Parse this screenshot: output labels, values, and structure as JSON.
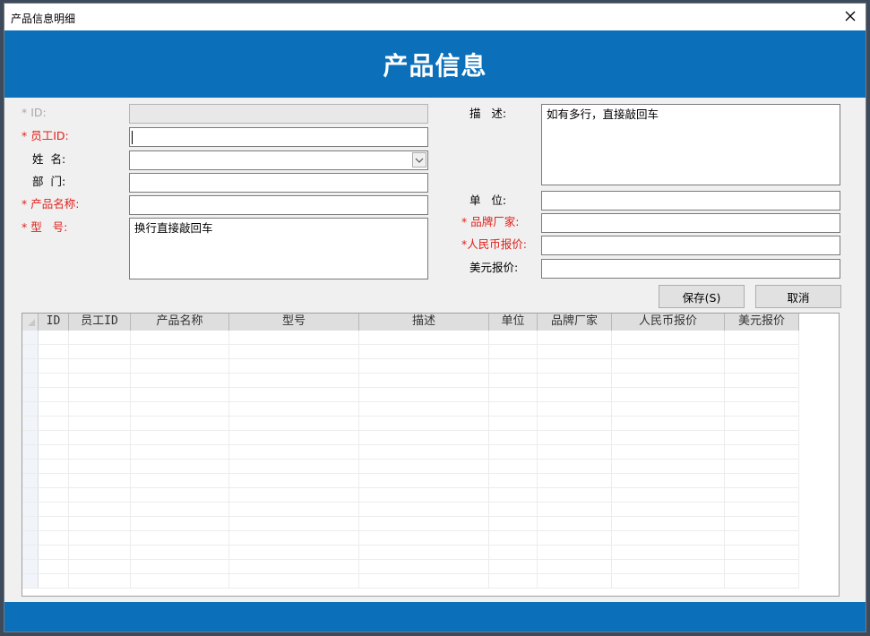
{
  "window": {
    "title": "产品信息明细",
    "header": "产品信息"
  },
  "form": {
    "id_label": "* ID:",
    "id_value": "",
    "employee_id_label": "* 员工ID:",
    "employee_id_value": "",
    "name_label": "姓  名:",
    "name_value": "",
    "department_label": "部  门:",
    "department_value": "",
    "product_name_label": "* 产品名称:",
    "product_name_value": "",
    "model_label": "* 型   号:",
    "model_value": "换行直接敲回车",
    "description_label": "描   述:",
    "description_value": "如有多行，直接敲回车",
    "unit_label": "单   位:",
    "unit_value": "",
    "brand_label": "* 品牌厂家:",
    "brand_value": "",
    "rmb_price_label": "*人民币报价:",
    "rmb_price_value": "",
    "usd_price_label": "美元报价:",
    "usd_price_value": ""
  },
  "buttons": {
    "save": "保存(S)",
    "cancel": "取消"
  },
  "grid": {
    "columns": [
      "ID",
      "员工ID",
      "产品名称",
      "型号",
      "描述",
      "单位",
      "品牌厂家",
      "人民币报价",
      "美元报价"
    ],
    "rows": []
  },
  "colors": {
    "banner": "#0b6fba",
    "required_label": "#e0201a"
  },
  "icons": {
    "close": "close-icon",
    "dropdown": "chevron-down-icon"
  }
}
